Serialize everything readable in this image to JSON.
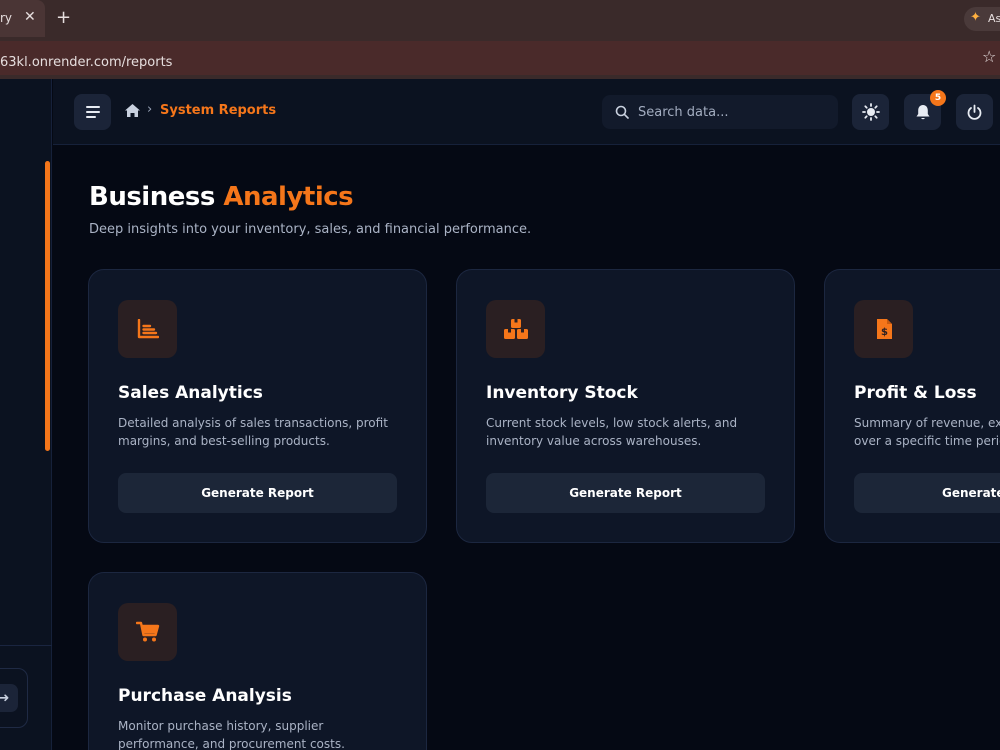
{
  "browser": {
    "tab_title": "ry",
    "tab_close": "✕",
    "new_tab": "+",
    "extension_label": "As",
    "url": "63kl.onrender.com/reports",
    "bookmark": "☆"
  },
  "header": {
    "breadcrumb_current": "System Reports",
    "search_placeholder": "Search data...",
    "notification_count": "5"
  },
  "page": {
    "title_main": "Business",
    "title_accent": "Analytics",
    "subtitle": "Deep insights into your inventory, sales, and financial performance."
  },
  "cards": [
    {
      "icon": "bar-chart-icon",
      "title": "Sales Analytics",
      "desc_line1": "Detailed analysis of sales transactions, profit",
      "desc_line2": "margins, and best-selling products.",
      "button": "Generate Report"
    },
    {
      "icon": "boxes-icon",
      "title": "Inventory Stock",
      "desc_line1": "Current stock levels, low stock alerts, and",
      "desc_line2": "inventory value across warehouses.",
      "button": "Generate Report"
    },
    {
      "icon": "invoice-dollar-icon",
      "title": "Profit & Loss",
      "desc_line1": "Summary of revenue, exp",
      "desc_line2": "over a specific time perio",
      "button": "Generate"
    },
    {
      "icon": "shopping-cart-icon",
      "title": "Purchase Analysis",
      "desc_line1": "Monitor purchase history, supplier",
      "desc_line2": "performance, and procurement costs."
    }
  ],
  "colors": {
    "accent": "#f5761a",
    "background": "#050914",
    "card": "#0e1627",
    "button": "#1c2638"
  }
}
